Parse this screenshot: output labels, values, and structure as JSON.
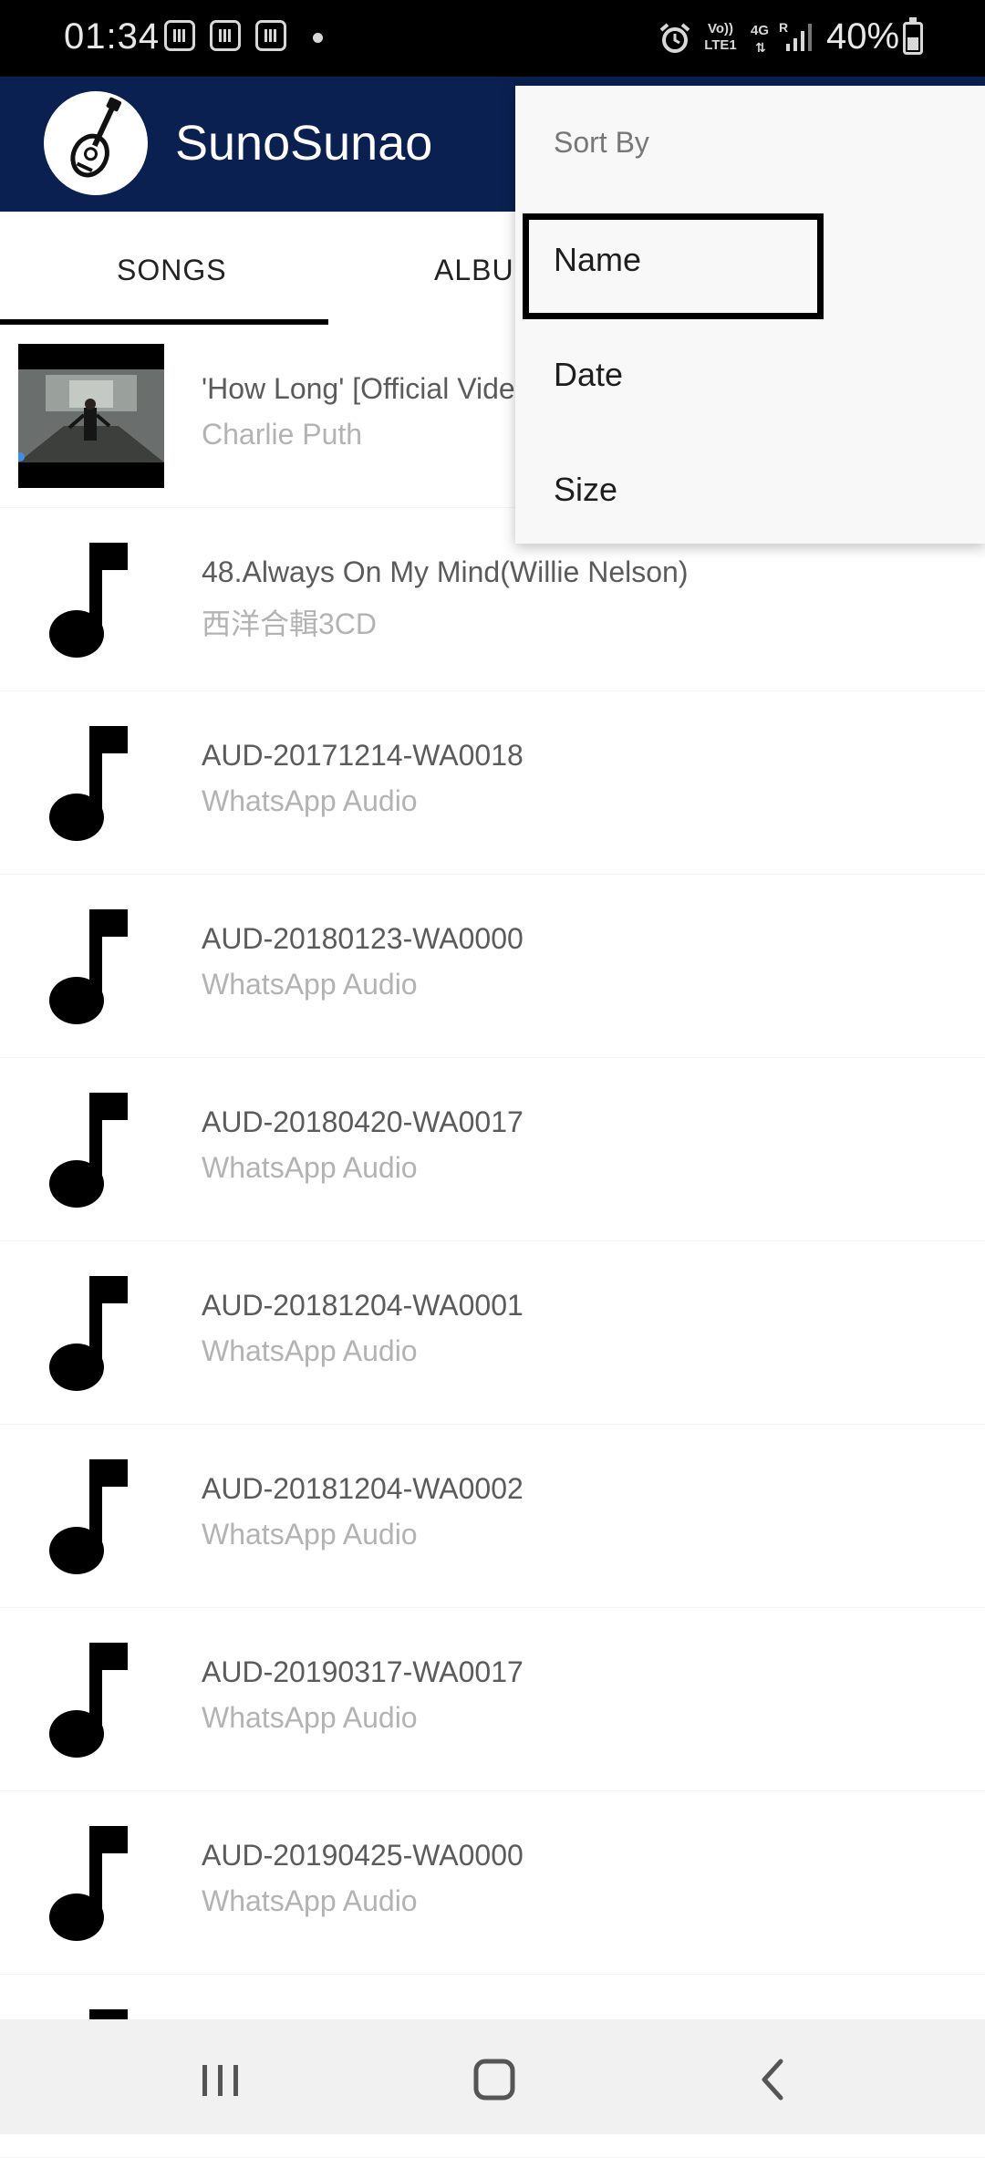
{
  "status_bar": {
    "time": "01:34",
    "network_top": "Vo))",
    "network_bottom": "LTE1",
    "network_type": "4G",
    "roaming": "R",
    "battery": "40%",
    "icons": [
      "notification-icon",
      "notification-icon",
      "notification-icon",
      "alarm-icon",
      "signal-icon",
      "battery-charging-icon"
    ]
  },
  "app_bar": {
    "title": "SunoSunao",
    "logo_icon": "guitar-logo-icon",
    "background": "#0a2050"
  },
  "tabs": [
    {
      "label": "SONGS",
      "selected": true
    },
    {
      "label": "ALBUMS",
      "selected": false
    }
  ],
  "songs": [
    {
      "title": "'How Long' [Official Video]",
      "artist": "Charlie Puth",
      "art": "video-thumbnail"
    },
    {
      "title": "48.Always On My Mind(Willie Nelson)",
      "artist": "西洋合輯3CD",
      "art": "music-note-icon"
    },
    {
      "title": "AUD-20171214-WA0018",
      "artist": "WhatsApp Audio",
      "art": "music-note-icon"
    },
    {
      "title": "AUD-20180123-WA0000",
      "artist": "WhatsApp Audio",
      "art": "music-note-icon"
    },
    {
      "title": "AUD-20180420-WA0017",
      "artist": "WhatsApp Audio",
      "art": "music-note-icon"
    },
    {
      "title": "AUD-20181204-WA0001",
      "artist": "WhatsApp Audio",
      "art": "music-note-icon"
    },
    {
      "title": "AUD-20181204-WA0002",
      "artist": "WhatsApp Audio",
      "art": "music-note-icon"
    },
    {
      "title": "AUD-20190317-WA0017",
      "artist": "WhatsApp Audio",
      "art": "music-note-icon"
    },
    {
      "title": "AUD-20190425-WA0000",
      "artist": "WhatsApp Audio",
      "art": "music-note-icon"
    }
  ],
  "sort_menu": {
    "header": "Sort By",
    "items": [
      "Name",
      "Date",
      "Size"
    ],
    "highlighted": "Name"
  },
  "nav_bar": {
    "buttons": [
      "recent-apps-icon",
      "home-icon",
      "back-icon"
    ]
  }
}
